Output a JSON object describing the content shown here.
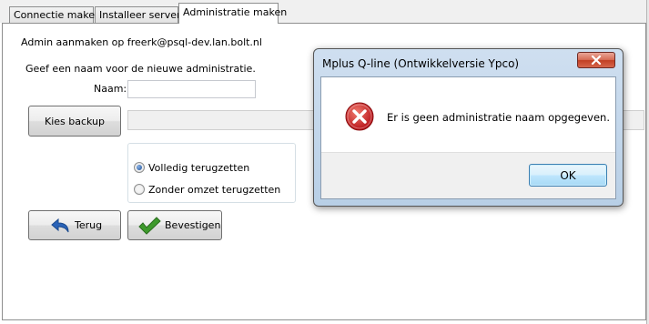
{
  "tabs": [
    {
      "label": "Connectie maken"
    },
    {
      "label": "Installeer server"
    },
    {
      "label": "Administratie maken"
    }
  ],
  "form": {
    "admin_info": "Admin aanmaken op freerk@psql-dev.lan.bolt.nl",
    "prompt": "Geef een naam voor de nieuwe administratie.",
    "name_label": "Naam:",
    "name_value": "",
    "kies_backup_label": "Kies backup",
    "backup_path_value": "",
    "restore_options": [
      {
        "label": "Volledig terugzetten",
        "selected": true
      },
      {
        "label": "Zonder omzet terugzetten",
        "selected": false
      }
    ],
    "back_label": "Terug",
    "confirm_label": "Bevestigen"
  },
  "dialog": {
    "title": "Mplus Q-line (Ontwikkelversie Ypco)",
    "icon": "error-icon",
    "message": "Er is geen administratie naam opgegeven.",
    "ok_label": "OK"
  },
  "colors": {
    "error_red": "#d42a2a",
    "back_arrow_blue": "#2a63b8",
    "check_green": "#3e9a2c",
    "dialog_frame": "#b8cfe6"
  }
}
